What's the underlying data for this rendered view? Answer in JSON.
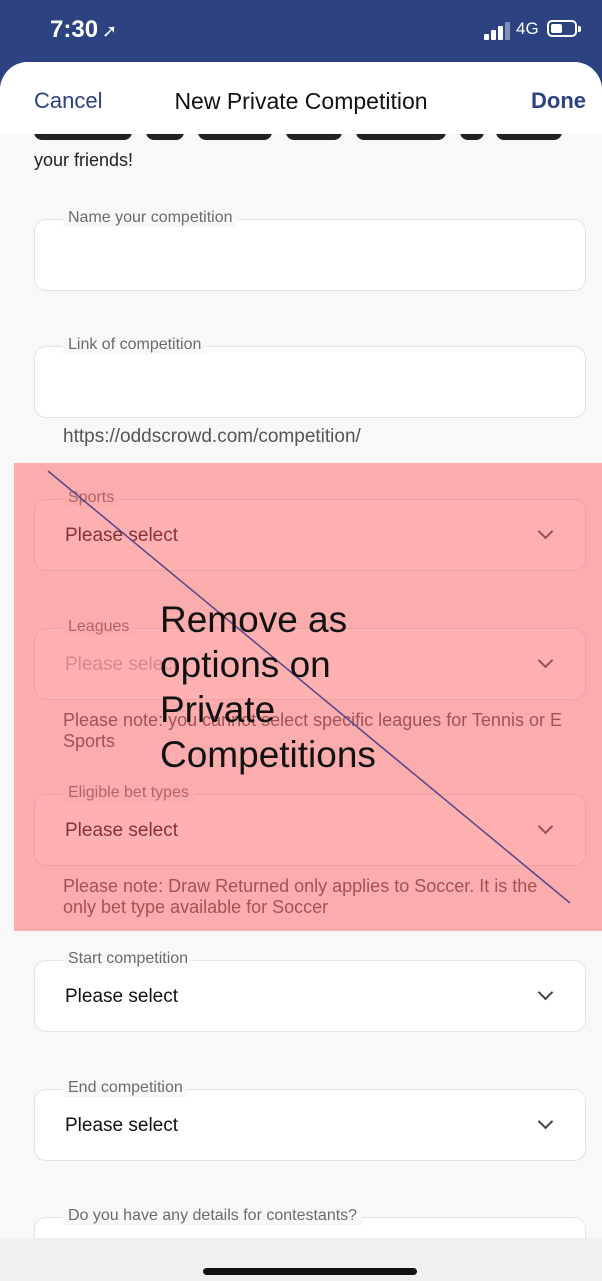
{
  "status_bar": {
    "time": "7:30",
    "network": "4G",
    "location_icon": "location-arrow-icon"
  },
  "header": {
    "cancel": "Cancel",
    "title": "New Private Competition",
    "done": "Done"
  },
  "intro_text": "your friends!",
  "fields": {
    "name": {
      "label": "Name your competition",
      "value": ""
    },
    "link": {
      "label": "Link of competition",
      "value": "",
      "helper": "https://oddscrowd.com/competition/"
    },
    "sports": {
      "label": "Sports",
      "value": "Please select"
    },
    "leagues": {
      "label": "Leagues",
      "value": "Please select",
      "note": "Please note: you cannot select specific leagues for Tennis or E Sports"
    },
    "bet_types": {
      "label": "Eligible bet types",
      "value": "Please select",
      "note": "Please note: Draw Returned only applies to Soccer. It is the only bet type available for Soccer"
    },
    "start": {
      "label": "Start competition",
      "value": "Please select"
    },
    "end": {
      "label": "End competition",
      "value": "Please select"
    },
    "details": {
      "label": "Do you have any details for contestants?"
    }
  },
  "annotation": {
    "text": "Remove as\noptions on\nPrivate\nCompetitions",
    "color": "#ff5a5a"
  }
}
